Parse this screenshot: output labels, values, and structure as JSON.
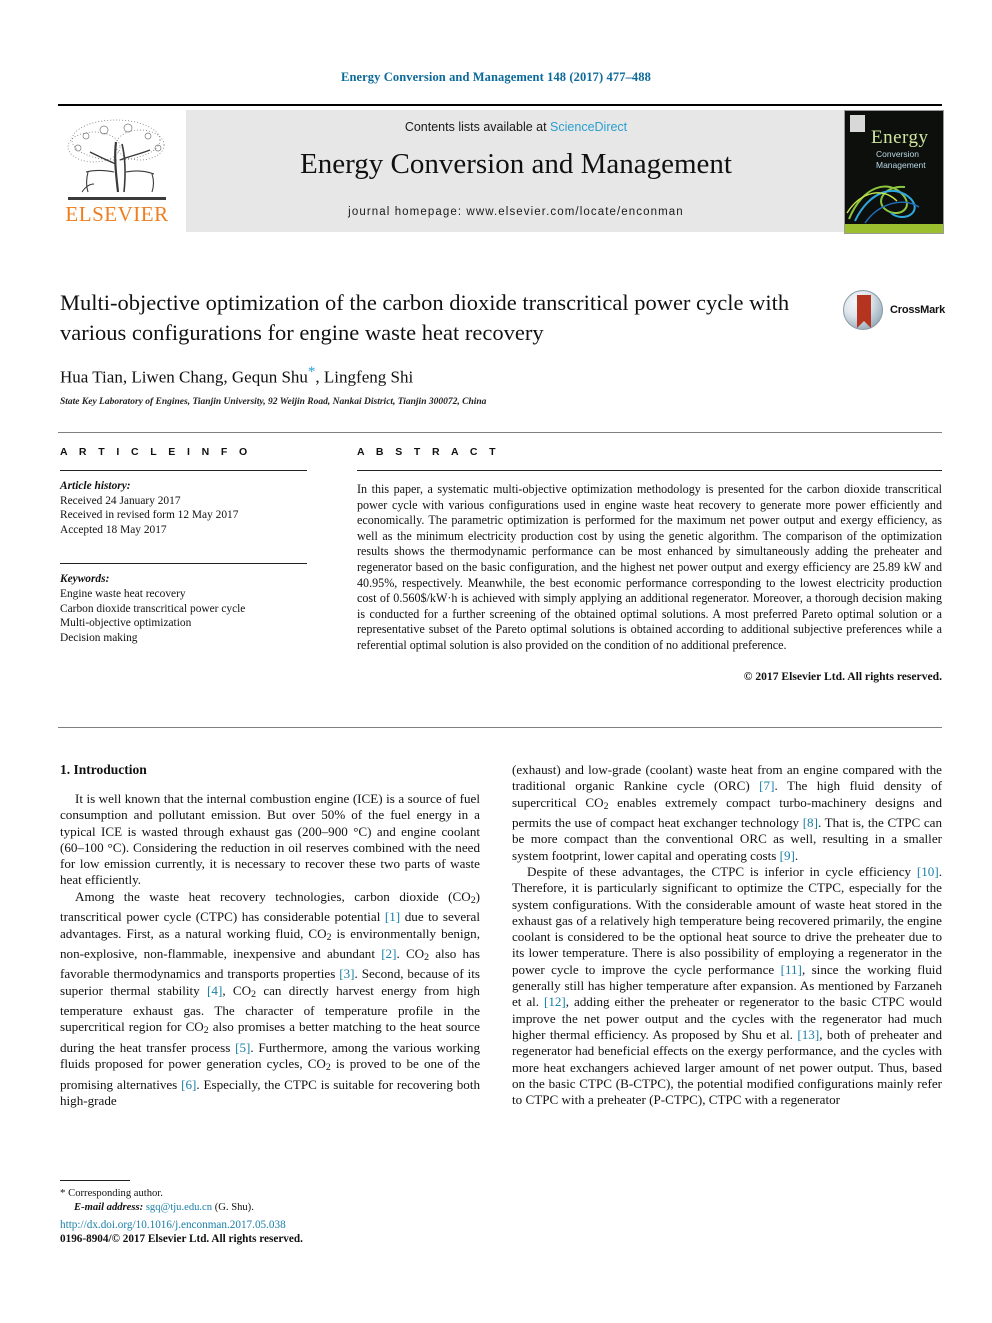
{
  "running_head": "Energy Conversion and Management 148 (2017) 477–488",
  "masthead": {
    "contents_prefix": "Contents lists available at ",
    "contents_link": "ScienceDirect",
    "journal_title": "Energy Conversion and Management",
    "homepage": "journal homepage: www.elsevier.com/locate/enconman",
    "publisher_logo_text": "ELSEVIER",
    "cover": {
      "title": "Energy",
      "subtitle1": "Conversion",
      "subtitle2": "Management"
    }
  },
  "article": {
    "title": "Multi-objective optimization of the carbon dioxide transcritical power cycle with various configurations for engine waste heat recovery",
    "authors": "Hua Tian, Liwen Chang, Gequn Shu",
    "authors_tail": ", Lingfeng Shi",
    "corresponding_marker": "*",
    "affiliation": "State Key Laboratory of Engines, Tianjin University, 92 Weijin Road, Nankai District, Tianjin 300072, China",
    "crossmark_label": "CrossMark"
  },
  "info": {
    "heading": "A R T I C L E   I N F O",
    "history_label": "Article history:",
    "history": [
      "Received 24 January 2017",
      "Received in revised form 12 May 2017",
      "Accepted 18 May 2017"
    ],
    "keywords_label": "Keywords:",
    "keywords": [
      "Engine waste heat recovery",
      "Carbon dioxide transcritical power cycle",
      "Multi-objective optimization",
      "Decision making"
    ]
  },
  "abstract": {
    "heading": "A B S T R A C T",
    "text": "In this paper, a systematic multi-objective optimization methodology is presented for the carbon dioxide transcritical power cycle with various configurations used in engine waste heat recovery to generate more power efficiently and economically. The parametric optimization is performed for the maximum net power output and exergy efficiency, as well as the minimum electricity production cost by using the genetic algorithm. The comparison of the optimization results shows the thermodynamic performance can be most enhanced by simultaneously adding the preheater and regenerator based on the basic configuration, and the highest net power output and exergy efficiency are 25.89 kW and 40.95%, respectively. Meanwhile, the best economic performance corresponding to the lowest electricity production cost of 0.560$/kW·h is achieved with simply applying an additional regenerator. Moreover, a thorough decision making is conducted for a further screening of the obtained optimal solutions. A most preferred Pareto optimal solution or a representative subset of the Pareto optimal solutions is obtained according to additional subjective preferences while a referential optimal solution is also provided on the condition of no additional preference.",
    "copyright": "© 2017 Elsevier Ltd. All rights reserved."
  },
  "body": {
    "section_title": "1. Introduction",
    "left_p1": "It is well known that the internal combustion engine (ICE) is a source of fuel consumption and pollutant emission. But over 50% of the fuel energy in a typical ICE is wasted through exhaust gas (200–900 °C) and engine coolant (60–100 °C). Considering the reduction in oil reserves combined with the need for low emission currently, it is necessary to recover these two parts of waste heat efficiently.",
    "right_p1_tail": "(exhaust) and low-grade (coolant) waste heat from an engine compared with the traditional organic Rankine cycle (ORC) [7]. The high fluid density of supercritical CO2 enables extremely compact turbo-machinery designs and permits the use of compact heat exchanger technology [8]. That is, the CTPC can be more compact than the conventional ORC as well, resulting in a smaller system footprint, lower capital and operating costs [9].",
    "right_p2": "Despite of these advantages, the CTPC is inferior in cycle efficiency [10]. Therefore, it is particularly significant to optimize the CTPC, especially for the system configurations. With the considerable amount of waste heat stored in the exhaust gas of a relatively high temperature being recovered primarily, the engine coolant is considered to be the optional heat source to drive the preheater due to its lower temperature. There is also possibility of employing a regenerator in the power cycle to improve the cycle performance [11], since the working fluid generally still has higher temperature after expansion. As mentioned by Farzaneh et al. [12], adding either the preheater or regenerator to the basic CTPC would improve the net power output and the cycles with the regenerator had much higher thermal efficiency. As proposed by Shu et al. [13], both of preheater and regenerator had beneficial effects on the exergy performance, and the cycles with more heat exchangers achieved larger amount of net power output. Thus, based on the basic CTPC (B-CTPC), the potential modified configurations mainly refer to CTPC with a preheater (P-CTPC), CTPC with a regenerator"
  },
  "footnote": {
    "corresponding": "Corresponding author.",
    "email_label": "E-mail address:",
    "email": "sgq@tju.edu.cn",
    "email_tail": "(G. Shu)."
  },
  "footer": {
    "doi": "http://dx.doi.org/10.1016/j.enconman.2017.05.038",
    "issn": "0196-8904/© 2017 Elsevier Ltd. All rights reserved."
  },
  "colors": {
    "link": "#1a7fa8",
    "running_head": "#0b6a9a",
    "elsevier_orange": "#f07e20",
    "sciencedirect": "#2a9fd0"
  }
}
